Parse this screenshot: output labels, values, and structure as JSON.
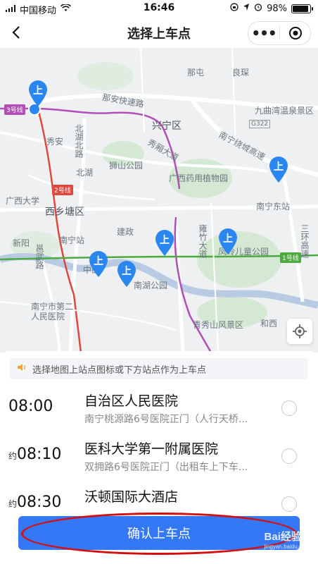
{
  "status_bar": {
    "carrier": "中国移动",
    "time": "16:46",
    "battery": "98%",
    "battery_level": 0.98,
    "icons": [
      "signal-icon",
      "wifi-icon",
      "orientation-lock-icon",
      "location-icon",
      "alarm-icon",
      "battery-icon"
    ]
  },
  "nav": {
    "title": "选择上车点",
    "more_label": "•••"
  },
  "map": {
    "labels": {
      "nacuo": "那屯",
      "lianghe": "良琛",
      "nananexpress": "那安快速路",
      "jiuquhot": "九曲湾温泉景区",
      "xingning": "兴宁区",
      "g322": "G322",
      "xiuan": "秀安",
      "beihubeilu": "北湖北路",
      "xiuxiang": "秀厢大道",
      "shishan": "狮山公园",
      "nanning_ring": "南宁绕城高速",
      "beihu": "北湖",
      "gxmedicine": "广西药用植物园",
      "gxu": "广西大学",
      "xixiangtang": "西乡塘区",
      "nanningdong": "南宁东站",
      "sanhuan": "三环高速",
      "nanningzhan": "南宁站",
      "jianzheng": "建政",
      "yongwu": "邕武路",
      "xinyang": "新阳",
      "yongzhu": "雍竹大道",
      "fenglinet": "凤岭儿童公园",
      "nanhu": "南湖公园",
      "zhongshan": "中山",
      "hospital2": "南宁市第二人民医院",
      "qingxiu": "青秀山风景区",
      "hexi": "和西"
    },
    "line_badges": {
      "line3": "3号线",
      "line2": "2号线",
      "line1": "1号线"
    },
    "pin_label": "上",
    "colors": {
      "pin": "#2a86f0",
      "line3": "#b24fb6",
      "line2": "#e0473f",
      "line1": "#4cab3f"
    }
  },
  "sheet": {
    "tip": "选择地图上站点图标或下方站点作为上车点",
    "stops": [
      {
        "approx": "",
        "time": "08:00",
        "name": "自治区人民医院",
        "address": "南宁桃源路6号医院正门（人行天桥..."
      },
      {
        "approx": "约",
        "time": "08:10",
        "name": "医科大学第一附属医院",
        "address": "双拥路6号医院正门（出租车上下车..."
      },
      {
        "approx": "约",
        "time": "08:30",
        "name": "沃顿国际大酒店",
        "address": ""
      }
    ],
    "confirm_label": "确认上车点"
  },
  "watermark": {
    "brand": "Bai",
    "brand_suffix": "经验",
    "url": "jingyan.baidu.com"
  }
}
